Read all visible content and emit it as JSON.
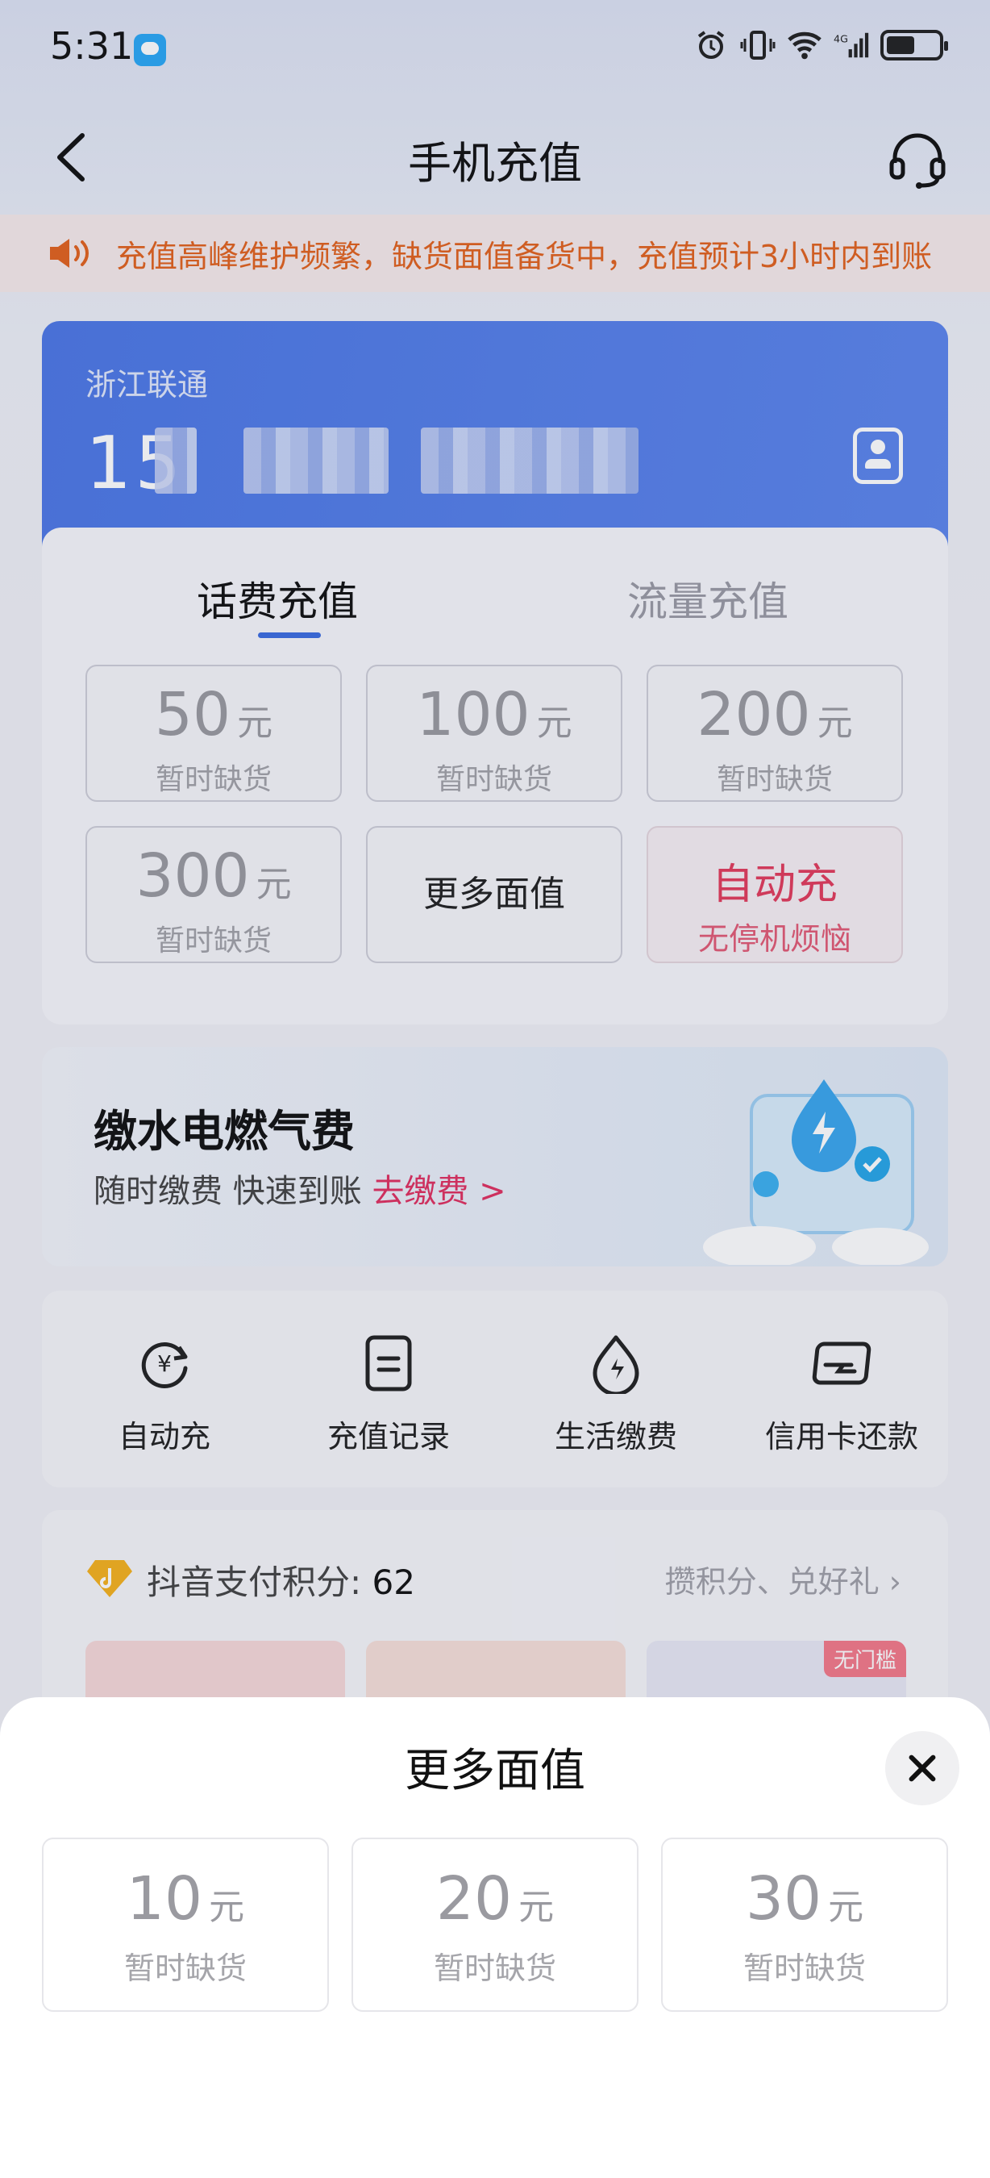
{
  "status_bar": {
    "time": "5:31",
    "network": "4G"
  },
  "nav": {
    "title": "手机充值",
    "back_icon": "chevron-left-icon",
    "service_icon": "headset-icon"
  },
  "notice": {
    "text": "充值高峰维护频繁，缺货面值备货中，充值预计3小时内到账"
  },
  "account": {
    "carrier": "浙江联通",
    "phone_prefix": "15"
  },
  "tabs": [
    {
      "label": "话费充值",
      "active": true
    },
    {
      "label": "流量充值",
      "active": false
    }
  ],
  "options": [
    {
      "value": "50",
      "unit": "元",
      "status": "暂时缺货"
    },
    {
      "value": "100",
      "unit": "元",
      "status": "暂时缺货"
    },
    {
      "value": "200",
      "unit": "元",
      "status": "暂时缺货"
    },
    {
      "value": "300",
      "unit": "元",
      "status": "暂时缺货"
    }
  ],
  "more_option": "更多面值",
  "auto_option": {
    "title": "自动充",
    "subtitle": "无停机烦恼"
  },
  "banner": {
    "title": "缴水电燃气费",
    "subtitle": "随时缴费 快速到账",
    "link": "去缴费 >"
  },
  "tools": [
    {
      "label": "自动充",
      "icon": "auto-recharge-icon"
    },
    {
      "label": "充值记录",
      "icon": "record-icon"
    },
    {
      "label": "生活缴费",
      "icon": "utility-icon"
    },
    {
      "label": "信用卡还款",
      "icon": "credit-card-icon"
    }
  ],
  "points": {
    "label": "抖音支付积分: ",
    "value": "62",
    "link": "攒积分、兑好礼",
    "tag": "无门槛"
  },
  "sheet": {
    "title": "更多面值",
    "options": [
      {
        "value": "10",
        "unit": "元",
        "status": "暂时缺货"
      },
      {
        "value": "20",
        "unit": "元",
        "status": "暂时缺货"
      },
      {
        "value": "30",
        "unit": "元",
        "status": "暂时缺货"
      }
    ]
  },
  "colors": {
    "primary": "#4d78e6",
    "warning": "#e2631e",
    "accent_red": "#e23b5c"
  }
}
